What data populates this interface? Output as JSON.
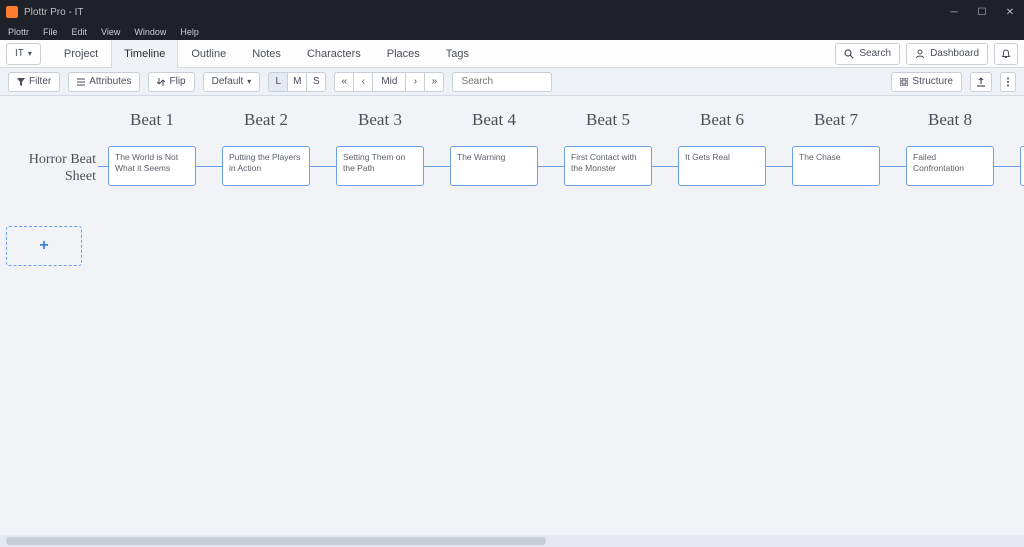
{
  "window": {
    "title": "Plottr Pro - IT"
  },
  "menubar": [
    "Plottr",
    "File",
    "Edit",
    "View",
    "Window",
    "Help"
  ],
  "topnav": {
    "book_button": "IT",
    "tabs": [
      {
        "label": "Project"
      },
      {
        "label": "Timeline",
        "active": true
      },
      {
        "label": "Outline"
      },
      {
        "label": "Notes"
      },
      {
        "label": "Characters"
      },
      {
        "label": "Places"
      },
      {
        "label": "Tags"
      }
    ],
    "search_btn": "Search",
    "dashboard_btn": "Dashboard"
  },
  "toolbar": {
    "filter": "Filter",
    "attributes": "Attributes",
    "flip": "Flip",
    "default": "Default",
    "zoom": {
      "L": "L",
      "M": "M",
      "S": "S"
    },
    "mid": "Mid",
    "search_placeholder": "Search",
    "structure": "Structure"
  },
  "timeline": {
    "row_label": "Horror Beat Sheet",
    "add_label": "+",
    "beats": [
      {
        "header": "Beat 1",
        "card": "The World is Not What it Seems"
      },
      {
        "header": "Beat 2",
        "card": "Putting the Players in Action"
      },
      {
        "header": "Beat 3",
        "card": "Setting Them on the Path"
      },
      {
        "header": "Beat 4",
        "card": "The Warning"
      },
      {
        "header": "Beat 5",
        "card": "First Contact with the Monster"
      },
      {
        "header": "Beat 6",
        "card": "It Gets Real"
      },
      {
        "header": "Beat 7",
        "card": "The Chase"
      },
      {
        "header": "Beat 8",
        "card": "Failed Confrontation"
      }
    ]
  }
}
